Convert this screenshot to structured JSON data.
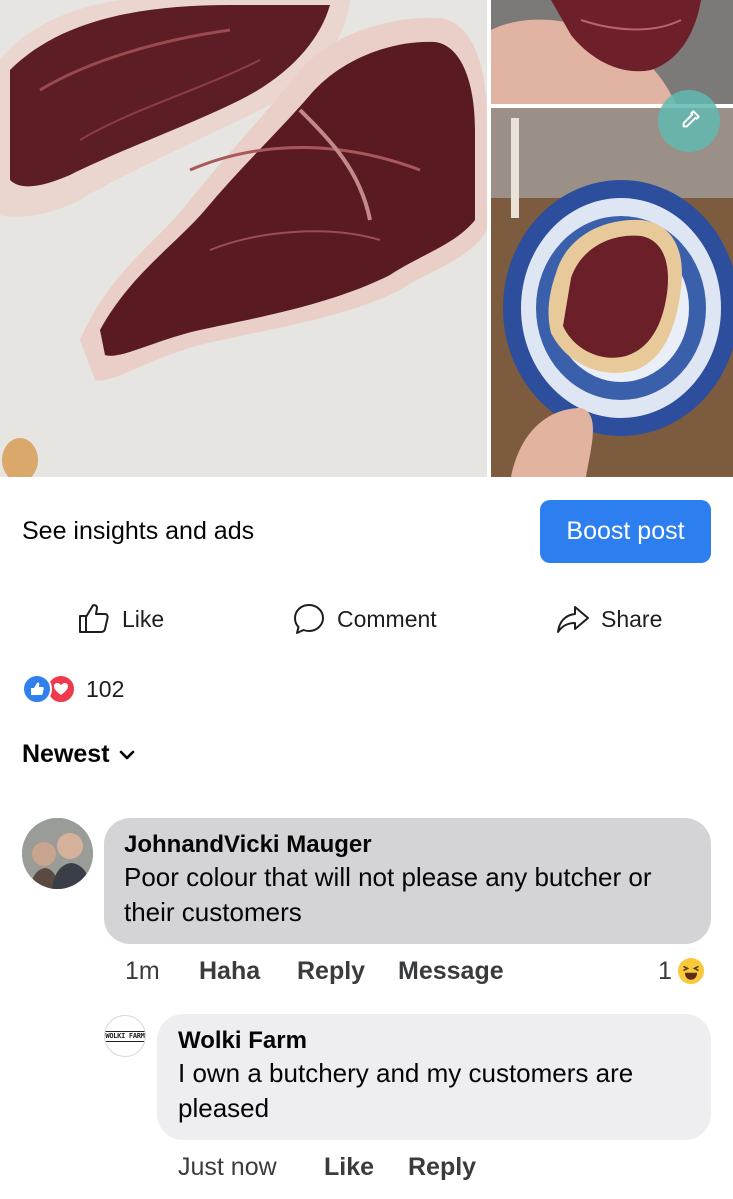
{
  "post": {
    "insights_label": "See insights and ads",
    "boost_label": "Boost post",
    "actions": {
      "like": "Like",
      "comment": "Comment",
      "share": "Share"
    },
    "reaction_count": "102",
    "sort_label": "Newest"
  },
  "colors": {
    "boost": "#2d7ff0",
    "like_reaction": "#2f80ed",
    "love_reaction": "#f0394c",
    "comment_bubble": "#d4d4d6",
    "reply_bubble": "#eeeef0"
  },
  "comments": [
    {
      "author": "JohnandVicki Mauger",
      "text": "Poor colour that will not please any butcher or their customers",
      "time": "1m",
      "haha": "Haha",
      "reply": "Reply",
      "message": "Message",
      "reaction_count": "1",
      "reaction_icon": "laughing-emoji"
    },
    {
      "author": "Wolki Farm",
      "avatar_text": "WOLKI FARM",
      "text": "I own a butchery and my customers are pleased",
      "time": "Just now",
      "like": "Like",
      "reply": "Reply"
    }
  ]
}
